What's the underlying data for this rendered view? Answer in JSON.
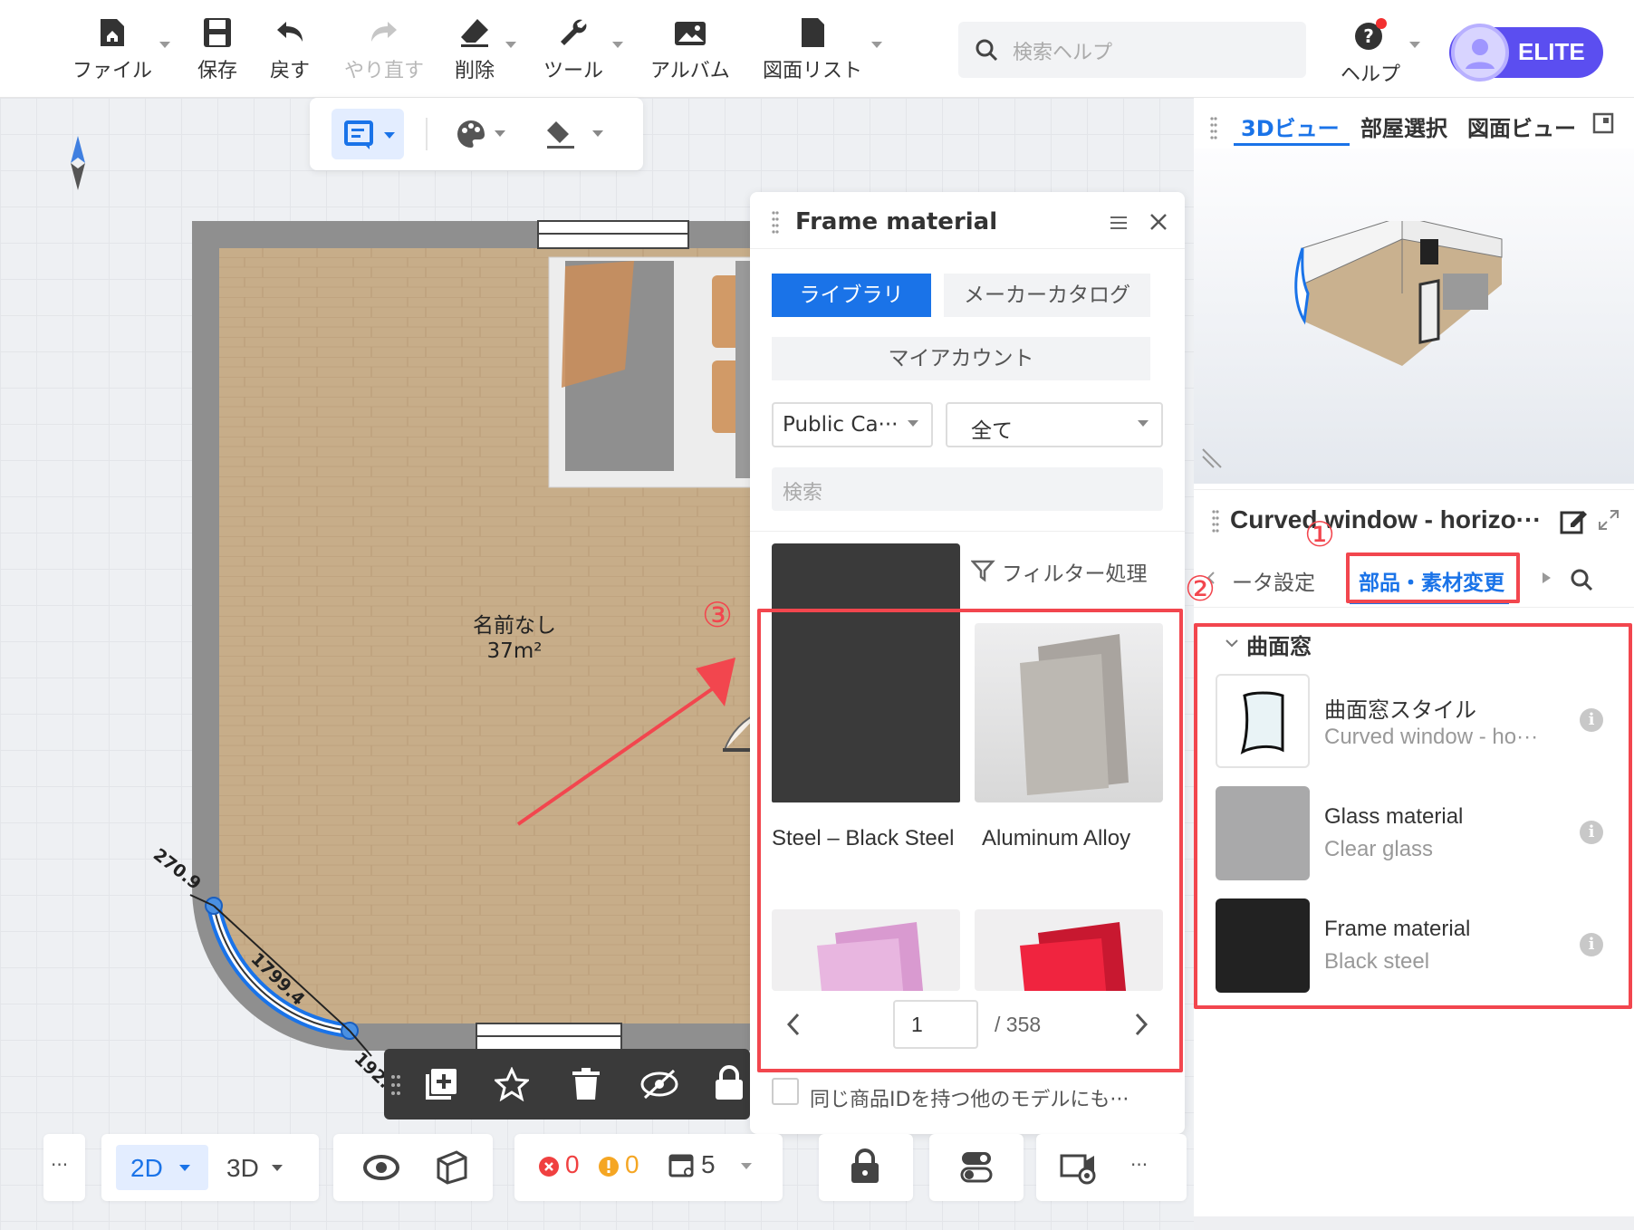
{
  "toolbar": {
    "file": "ファイル",
    "save": "保存",
    "undo": "戻す",
    "redo": "やり直す",
    "delete": "削除",
    "tools": "ツール",
    "album": "アルバム",
    "drawing_list": "図面リスト",
    "search_placeholder": "検索ヘルプ",
    "help": "ヘルプ",
    "plan_badge": "ELITE"
  },
  "canvas": {
    "room_name": "名前なし",
    "room_area": "37m²",
    "dim_1": "270.9",
    "dim_2": "1799.4",
    "dim_3": "192."
  },
  "frame_panel": {
    "title": "Frame material",
    "tab_library": "ライブラリ",
    "tab_catalog": "メーカーカタログ",
    "tab_account": "マイアカウント",
    "select_source": "Public Ca···",
    "select_category": "全て",
    "search_placeholder": "検索",
    "filter_label": "フィルター処理",
    "materials": [
      {
        "name": "Steel – Black Steel",
        "color": "#3a3a3a"
      },
      {
        "name": "Aluminum Alloy",
        "color": "#b9b6b1"
      },
      {
        "name": "",
        "color": "#e5b3dc"
      },
      {
        "name": "",
        "color": "#f0243f"
      }
    ],
    "page_current": "1",
    "page_total": "/ 358",
    "same_id_label": "同じ商品IDを持つ他のモデルにも···"
  },
  "right_panel": {
    "tab_3d": "3Dビュー",
    "tab_room": "部屋選択",
    "tab_drawing": "図面ビュー",
    "object_title": "Curved window - horizo···",
    "subtab_params": "ータ設定",
    "subtab_parts": "部品・素材変更",
    "section_title": "曲面窓",
    "rows": [
      {
        "name": "曲面窓スタイル",
        "sub": "Curved window - ho···",
        "color": "#ffffff"
      },
      {
        "name": "Glass material",
        "sub": "Clear glass",
        "color": "#a9a9aa"
      },
      {
        "name": "Frame material",
        "sub": "Black steel",
        "color": "#222222"
      }
    ]
  },
  "annotations": {
    "n1": "①",
    "n2": "②",
    "n3": "③"
  },
  "bottom_bar": {
    "more": "···",
    "mode_2d": "2D",
    "mode_3d": "3D",
    "errors": "0",
    "warnings": "0",
    "objects": "5",
    "more_right": "···"
  },
  "colors": {
    "accent": "#1a73e8",
    "highlight_red": "#f2464e",
    "elite_purple": "#5b4ef0",
    "floor": "#c9b18f",
    "wall": "#8f8f8f"
  }
}
